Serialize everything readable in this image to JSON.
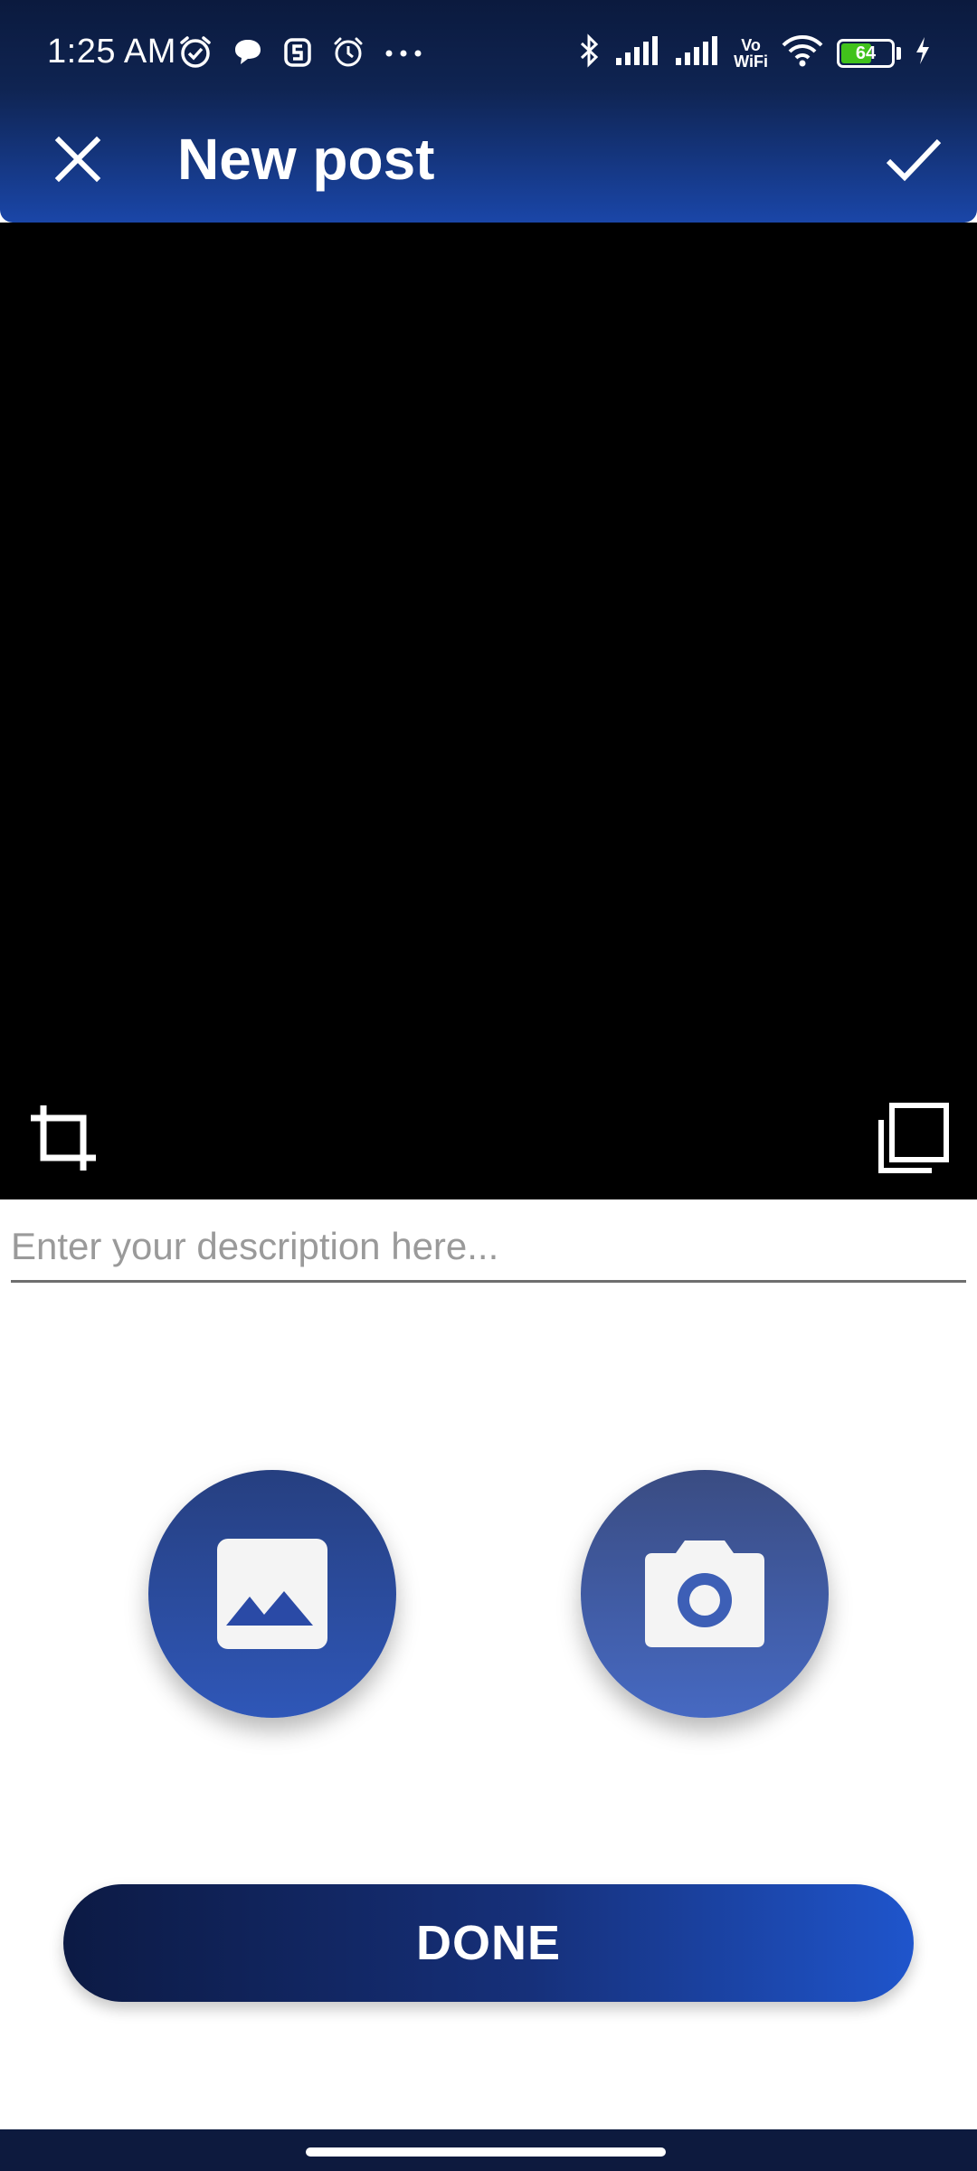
{
  "status_bar": {
    "time": "1:25 AM",
    "battery_level": "64",
    "battery_fraction": 0.64,
    "vowifi_top": "Vo",
    "vowifi_bottom": "WiFi",
    "left_icons": [
      "alarm-check-icon",
      "chat-bubble-icon",
      "app-s-icon",
      "alarm-icon",
      "more-dots-icon"
    ],
    "right_icons": [
      "bluetooth-icon",
      "signal-icon",
      "signal-icon",
      "vowifi-icon",
      "wifi-icon",
      "battery-icon",
      "charging-icon"
    ]
  },
  "app_bar": {
    "title": "New post",
    "close_icon": "close-icon",
    "confirm_icon": "check-icon"
  },
  "preview": {
    "crop_icon": "crop-icon",
    "aspect_icon": "aspect-ratio-icon"
  },
  "description": {
    "placeholder": "Enter your description here...",
    "value": ""
  },
  "actions": {
    "gallery_icon": "gallery-image-icon",
    "camera_icon": "camera-icon"
  },
  "done_button": {
    "label": "DONE"
  },
  "colors": {
    "primary_dark": "#0c1a44",
    "primary": "#1f55cc",
    "battery_green": "#41c21c"
  }
}
